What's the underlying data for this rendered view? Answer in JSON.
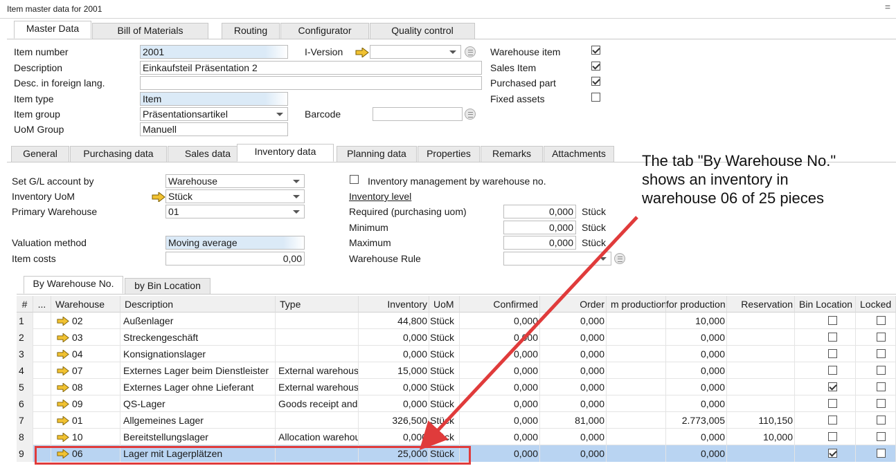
{
  "window": {
    "title": "Item master data for 2001",
    "menu_glyph": "="
  },
  "top_tabs": [
    "Master Data",
    "Bill of Materials",
    "Routing",
    "Configurator",
    "Quality control"
  ],
  "header": {
    "item_number_label": "Item number",
    "item_number": "2001",
    "description_label": "Description",
    "description": "Einkaufsteil Präsentation 2",
    "foreign_label": "Desc. in foreign lang.",
    "foreign": "",
    "item_type_label": "Item type",
    "item_type": "Item",
    "item_group_label": "Item group",
    "item_group": "Präsentationsartikel",
    "uom_group_label": "UoM Group",
    "uom_group": "Manuell",
    "iversion_label": "I-Version",
    "iversion": "",
    "barcode_label": "Barcode",
    "barcode": "",
    "warehouse_item_label": "Warehouse item",
    "warehouse_item": true,
    "sales_item_label": "Sales Item",
    "sales_item": true,
    "purchased_part_label": "Purchased part",
    "purchased_part": true,
    "fixed_assets_label": "Fixed assets",
    "fixed_assets": false
  },
  "sub_tabs": [
    "General",
    "Purchasing data",
    "Sales data",
    "Inventory data",
    "Planning data",
    "Properties",
    "Remarks",
    "Attachments"
  ],
  "inventory": {
    "gl_label": "Set G/L account by",
    "gl_value": "Warehouse",
    "uom_label": "Inventory UoM",
    "uom_value": "Stück",
    "primary_label": "Primary Warehouse",
    "primary_value": "01",
    "valuation_label": "Valuation method",
    "valuation_value": "Moving average",
    "costs_label": "Item costs",
    "costs_value": "0,00",
    "mgmt_label": "Inventory management by warehouse no.",
    "mgmt_checked": false,
    "level_label": "Inventory level",
    "required_label": "Required (purchasing uom)",
    "required_value": "0,000",
    "required_unit": "Stück",
    "minimum_label": "Minimum",
    "minimum_value": "0,000",
    "minimum_unit": "Stück",
    "maximum_label": "Maximum",
    "maximum_value": "0,000",
    "maximum_unit": "Stück",
    "rule_label": "Warehouse Rule",
    "rule_value": ""
  },
  "wh_tabs": [
    "By Warehouse No.",
    "by Bin Location"
  ],
  "grid": {
    "columns": [
      "#",
      "...",
      "Warehouse",
      "Description",
      "Type",
      "Inventory",
      "UoM",
      "Confirmed",
      "Order",
      "m production",
      "for production",
      "Reservation",
      "Bin Location",
      "Locked"
    ],
    "rows": [
      [
        "1",
        "02",
        "Außenlager",
        "",
        "44,800",
        "Stück",
        "0,000",
        "0,000",
        "",
        "10,000",
        "",
        false,
        false
      ],
      [
        "2",
        "03",
        "Streckengeschäft",
        "",
        "0,000",
        "Stück",
        "0,000",
        "0,000",
        "",
        "0,000",
        "",
        false,
        false
      ],
      [
        "3",
        "04",
        "Konsignationslager",
        "",
        "0,000",
        "Stück",
        "0,000",
        "0,000",
        "",
        "0,000",
        "",
        false,
        false
      ],
      [
        "4",
        "07",
        "Externes Lager beim Dienstleister",
        "External warehouse",
        "15,000",
        "Stück",
        "0,000",
        "0,000",
        "",
        "0,000",
        "",
        false,
        false
      ],
      [
        "5",
        "08",
        "Externes Lager ohne Lieferant",
        "External warehouse",
        "0,000",
        "Stück",
        "0,000",
        "0,000",
        "",
        "0,000",
        "",
        true,
        false
      ],
      [
        "6",
        "09",
        "QS-Lager",
        "Goods receipt and",
        "0,000",
        "Stück",
        "0,000",
        "0,000",
        "",
        "0,000",
        "",
        false,
        false
      ],
      [
        "7",
        "01",
        "Allgemeines Lager",
        "",
        "326,500",
        "Stück",
        "0,000",
        "81,000",
        "",
        "2.773,005",
        "110,150",
        false,
        false
      ],
      [
        "8",
        "10",
        "Bereitstellungslager",
        "Allocation warehouse",
        "0,000",
        "Stück",
        "0,000",
        "0,000",
        "",
        "0,000",
        "10,000",
        false,
        false
      ],
      [
        "9",
        "06",
        "Lager mit Lagerplätzen",
        "",
        "25,000",
        "Stück",
        "0,000",
        "0,000",
        "",
        "0,000",
        "",
        true,
        false
      ]
    ],
    "selected_row": 8
  },
  "annotation": {
    "lines": [
      "The tab \"By Warehouse No.\"",
      "shows an inventory in",
      "warehouse 06 of 25 pieces"
    ],
    "color": "#e03b3b"
  }
}
